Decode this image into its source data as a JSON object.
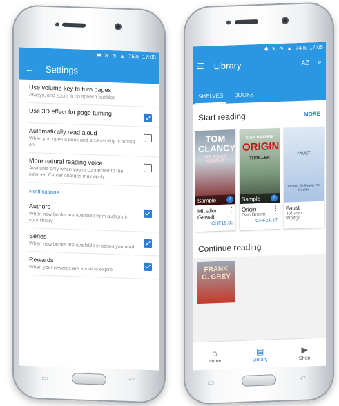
{
  "left": {
    "status": {
      "icons": "✱ ✕ ⊙ ▲",
      "battery": "75%",
      "time": "17:05"
    },
    "appbar": {
      "title": "Settings"
    },
    "settings": [
      {
        "title": "Use volume key to turn pages",
        "desc": "Always, and zoom in on speech bubbles",
        "checked": null
      },
      {
        "title": "Use 3D effect for page turning",
        "desc": "",
        "checked": true
      },
      {
        "title": "Automatically read aloud",
        "desc": "When you open a book and accessibility is turned on",
        "checked": false
      },
      {
        "title": "More natural reading voice",
        "desc": "Available only when you're connected to the Internet. Carrier charges may apply.",
        "checked": false
      }
    ],
    "section_label": "Notifications",
    "notifications": [
      {
        "title": "Authors",
        "desc": "When new books are available from authors in your library",
        "checked": true
      },
      {
        "title": "Series",
        "desc": "When new books are available in series you read",
        "checked": true
      },
      {
        "title": "Rewards",
        "desc": "When your rewards are about to expire",
        "checked": true
      }
    ]
  },
  "right": {
    "status": {
      "icons": "✱ ✕ ⊙ ▲",
      "battery": "74%",
      "time": "17:05"
    },
    "appbar": {
      "title": "Library",
      "sort_label": "AZ"
    },
    "tabs": [
      {
        "label": "SHELVES"
      },
      {
        "label": "BOOKS"
      }
    ],
    "start_reading": {
      "title": "Start reading",
      "more": "MORE"
    },
    "books": [
      {
        "cover_author": "TOM CLANCY",
        "cover_subtitle": "MIT ALLER GEWALT",
        "sample": "Sample",
        "title": "Mit aller Gewalt",
        "author": "",
        "price": "CHF16.80"
      },
      {
        "cover_author": "DAN BROWN",
        "cover_big": "ORIGIN",
        "cover_subtitle": "THRILLER",
        "sample": "Sample",
        "title": "Origin",
        "author": "Dan Brown",
        "price": "CHF21.17"
      },
      {
        "cover_title": "FAUST",
        "cover_subtitle": "Johann Wolfgang von Goethe",
        "title": "Faust",
        "author": "Johann Wolfga...",
        "price": ""
      }
    ],
    "continue_reading": {
      "title": "Continue reading",
      "cover_text": "FRANK G. GREY"
    },
    "bottom_nav": [
      {
        "label": "Home",
        "icon": "⌂"
      },
      {
        "label": "Library",
        "icon": "▤"
      },
      {
        "label": "Shop",
        "icon": "▶"
      }
    ]
  }
}
